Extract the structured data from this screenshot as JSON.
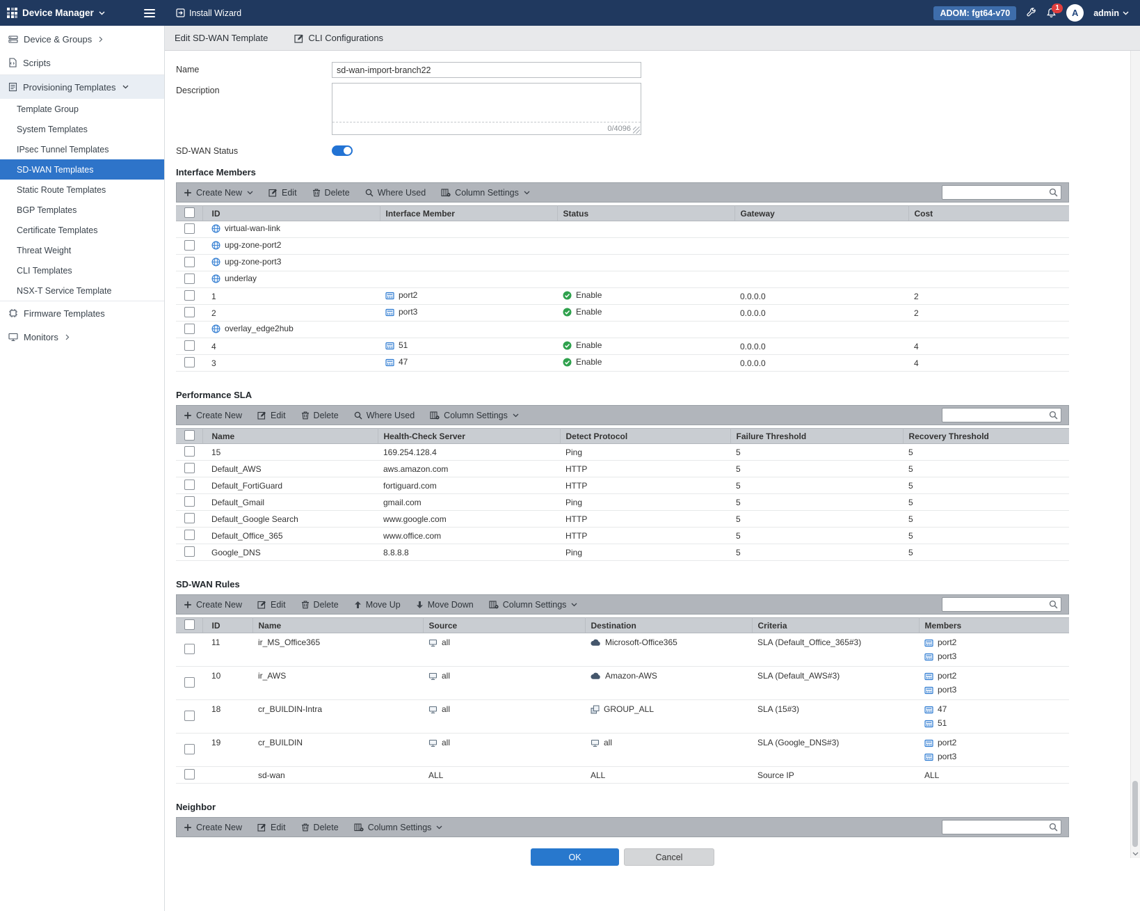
{
  "topbar": {
    "title": "Device Manager",
    "install_wizard": "Install Wizard",
    "adom_label": "ADOM: fgt64-v70",
    "notification_count": "1",
    "avatar_letter": "A",
    "username": "admin"
  },
  "sidebar": {
    "device_groups": "Device & Groups",
    "scripts": "Scripts",
    "provisioning": "Provisioning Templates",
    "provisioning_children": [
      "Template Group",
      "System Templates",
      "IPsec Tunnel Templates",
      "SD-WAN Templates",
      "Static Route Templates",
      "BGP Templates",
      "Certificate Templates",
      "Threat Weight",
      "CLI Templates",
      "NSX-T Service Template"
    ],
    "selected_child": "SD-WAN Templates",
    "firmware": "Firmware Templates",
    "monitors": "Monitors"
  },
  "tabs": {
    "edit_sdwan_template": "Edit SD-WAN Template",
    "cli_configurations": "CLI Configurations"
  },
  "form": {
    "name_label": "Name",
    "name_value": "sd-wan-import-branch22",
    "description_label": "Description",
    "description_value": "",
    "char_counter": "0/4096",
    "status_label": "SD-WAN Status",
    "status_on": true
  },
  "toolbar_labels": {
    "create_new": "Create New",
    "edit": "Edit",
    "delete": "Delete",
    "where_used": "Where Used",
    "column_settings": "Column Settings",
    "move_up": "Move Up",
    "move_down": "Move Down"
  },
  "sections": {
    "interface_members": {
      "title": "Interface Members",
      "columns": [
        "ID",
        "Interface Member",
        "Status",
        "Gateway",
        "Cost"
      ],
      "rows": [
        {
          "cells": [
            {
              "icon": "zone-icon",
              "text": "virtual-wan-link"
            },
            "",
            "",
            "",
            ""
          ]
        },
        {
          "cells": [
            {
              "icon": "zone-icon",
              "text": "upg-zone-port2"
            },
            "",
            "",
            "",
            ""
          ]
        },
        {
          "cells": [
            {
              "icon": "zone-icon",
              "text": "upg-zone-port3"
            },
            "",
            "",
            "",
            ""
          ]
        },
        {
          "cells": [
            {
              "icon": "zone-icon",
              "text": "underlay"
            },
            "",
            "",
            "",
            ""
          ]
        },
        {
          "cells": [
            "1",
            {
              "icon": "interface-icon",
              "text": "port2"
            },
            {
              "icon": "enable-icon",
              "text": "Enable"
            },
            "0.0.0.0",
            "2"
          ]
        },
        {
          "cells": [
            "2",
            {
              "icon": "interface-icon",
              "text": "port3"
            },
            {
              "icon": "enable-icon",
              "text": "Enable"
            },
            "0.0.0.0",
            "2"
          ]
        },
        {
          "cells": [
            {
              "icon": "zone-icon",
              "text": "overlay_edge2hub"
            },
            "",
            "",
            "",
            ""
          ]
        },
        {
          "cells": [
            "4",
            {
              "icon": "interface-icon",
              "text": "51"
            },
            {
              "icon": "enable-icon",
              "text": "Enable"
            },
            "0.0.0.0",
            "4"
          ]
        },
        {
          "cells": [
            "3",
            {
              "icon": "interface-icon",
              "text": "47"
            },
            {
              "icon": "enable-icon",
              "text": "Enable"
            },
            "0.0.0.0",
            "4"
          ]
        }
      ]
    },
    "performance_sla": {
      "title": "Performance SLA",
      "columns": [
        "Name",
        "Health-Check Server",
        "Detect Protocol",
        "Failure Threshold",
        "Recovery Threshold"
      ],
      "rows": [
        {
          "cells": [
            "15",
            "169.254.128.4",
            "Ping",
            "5",
            "5"
          ]
        },
        {
          "cells": [
            "Default_AWS",
            "aws.amazon.com",
            "HTTP",
            "5",
            "5"
          ]
        },
        {
          "cells": [
            "Default_FortiGuard",
            "fortiguard.com",
            "HTTP",
            "5",
            "5"
          ]
        },
        {
          "cells": [
            "Default_Gmail",
            "gmail.com",
            "Ping",
            "5",
            "5"
          ]
        },
        {
          "cells": [
            "Default_Google Search",
            "www.google.com",
            "HTTP",
            "5",
            "5"
          ]
        },
        {
          "cells": [
            "Default_Office_365",
            "www.office.com",
            "HTTP",
            "5",
            "5"
          ]
        },
        {
          "cells": [
            "Google_DNS",
            "8.8.8.8",
            "Ping",
            "5",
            "5"
          ]
        }
      ]
    },
    "sdwan_rules": {
      "title": "SD-WAN Rules",
      "columns": [
        "ID",
        "Name",
        "Source",
        "Destination",
        "Criteria",
        "Members"
      ],
      "rows": [
        {
          "cells": [
            "11",
            "ir_MS_Office365",
            {
              "icon": "address-icon",
              "text": "all"
            },
            {
              "icon": "cloud-icon",
              "text": "Microsoft-Office365"
            },
            "SLA (Default_Office_365#3)",
            [
              {
                "icon": "interface-icon",
                "text": "port2"
              },
              {
                "icon": "interface-icon",
                "text": "port3"
              }
            ]
          ]
        },
        {
          "cells": [
            "10",
            "ir_AWS",
            {
              "icon": "address-icon",
              "text": "all"
            },
            {
              "icon": "cloud-icon",
              "text": "Amazon-AWS"
            },
            "SLA (Default_AWS#3)",
            [
              {
                "icon": "interface-icon",
                "text": "port2"
              },
              {
                "icon": "interface-icon",
                "text": "port3"
              }
            ]
          ]
        },
        {
          "cells": [
            "18",
            "cr_BUILDIN-Intra",
            {
              "icon": "address-icon",
              "text": "all"
            },
            {
              "icon": "address-group-icon",
              "text": "GROUP_ALL"
            },
            "SLA (15#3)",
            [
              {
                "icon": "interface-icon",
                "text": "47"
              },
              {
                "icon": "interface-icon",
                "text": "51"
              }
            ]
          ]
        },
        {
          "cells": [
            "19",
            "cr_BUILDIN",
            {
              "icon": "address-icon",
              "text": "all"
            },
            {
              "icon": "address-icon",
              "text": "all"
            },
            "SLA (Google_DNS#3)",
            [
              {
                "icon": "interface-icon",
                "text": "port2"
              },
              {
                "icon": "interface-icon",
                "text": "port3"
              }
            ]
          ]
        },
        {
          "cells": [
            "",
            "sd-wan",
            "ALL",
            "ALL",
            "Source IP",
            "ALL"
          ]
        }
      ]
    },
    "neighbor": {
      "title": "Neighbor"
    }
  },
  "footer": {
    "ok": "OK",
    "cancel": "Cancel"
  },
  "colors": {
    "topbar_bg": "#20395f",
    "selected_nav": "#2e74c9",
    "toolbar_bg": "#b1b5bb",
    "table_header_bg": "#c9cdd2",
    "ok_button": "#2878cd",
    "enable_green": "#2fa14d",
    "notification_red": "#e03e3e",
    "toggle_on_blue": "#2273d4"
  }
}
